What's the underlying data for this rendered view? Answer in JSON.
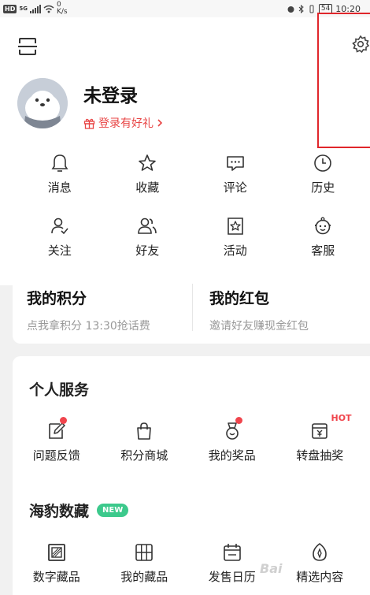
{
  "status_bar": {
    "hd": "HD",
    "net": "5G",
    "speed_value": "0",
    "speed_unit": "K/s",
    "battery": "54",
    "time": "10:20"
  },
  "profile": {
    "username": "未登录",
    "login_gift": "登录有好礼"
  },
  "quick_actions_row1": [
    {
      "label": "消息",
      "icon": "bell-icon"
    },
    {
      "label": "收藏",
      "icon": "star-icon"
    },
    {
      "label": "评论",
      "icon": "comment-icon"
    },
    {
      "label": "历史",
      "icon": "clock-icon"
    }
  ],
  "quick_actions_row2": [
    {
      "label": "关注",
      "icon": "follow-icon"
    },
    {
      "label": "好友",
      "icon": "friends-icon"
    },
    {
      "label": "活动",
      "icon": "activity-icon"
    },
    {
      "label": "客服",
      "icon": "service-icon"
    }
  ],
  "points": {
    "title": "我的积分",
    "subtitle": "点我拿积分 13:30抢话费"
  },
  "red_packet": {
    "title": "我的红包",
    "subtitle": "邀请好友赚现金红包"
  },
  "personal_services": {
    "title": "个人服务",
    "items": [
      {
        "label": "问题反馈",
        "icon": "feedback-icon"
      },
      {
        "label": "积分商城",
        "icon": "shopping-bag-icon"
      },
      {
        "label": "我的奖品",
        "icon": "medal-icon"
      },
      {
        "label": "转盘抽奖",
        "icon": "lottery-icon",
        "tag": "HOT"
      }
    ]
  },
  "collection": {
    "title": "海豹数藏",
    "badge": "NEW",
    "items": [
      {
        "label": "数字藏品",
        "icon": "digital-collection-icon"
      },
      {
        "label": "我的藏品",
        "icon": "grid-icon"
      },
      {
        "label": "发售日历",
        "icon": "calendar-icon"
      },
      {
        "label": "精选内容",
        "icon": "featured-icon"
      }
    ]
  },
  "watermark": "Bai"
}
